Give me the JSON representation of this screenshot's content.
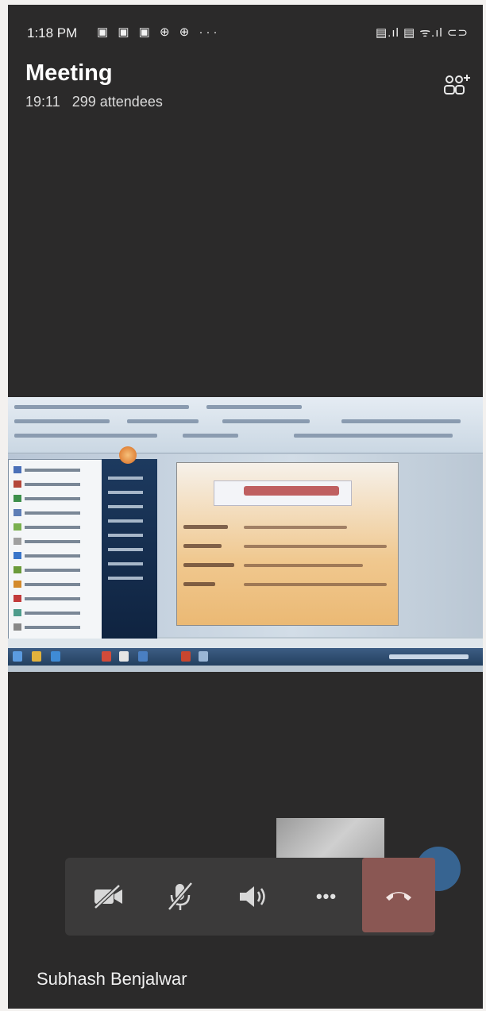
{
  "status_bar": {
    "time": "1:18 PM",
    "notification_icons": "▣ ▣ ▣ ⊕ ⊕ ···",
    "system_icons": "▤.ıl ▤ ᯤ.ıl ⊂⊃"
  },
  "meeting": {
    "title": "Meeting",
    "duration": "19:11",
    "attendees": "299 attendees"
  },
  "icons": {
    "people_add": "people-add-icon",
    "camera_off": "camera-off-icon",
    "mic_off": "microphone-off-icon",
    "speaker": "speaker-icon",
    "more": "more-options-icon",
    "hang_up": "hang-up-icon"
  },
  "controls": {
    "more_label": "•••"
  },
  "participant": {
    "name": "Subhash Benjalwar"
  },
  "colors": {
    "background": "#2b2a2a",
    "control_bar": "#3b3a3a",
    "hang_up": "#8a5753"
  }
}
